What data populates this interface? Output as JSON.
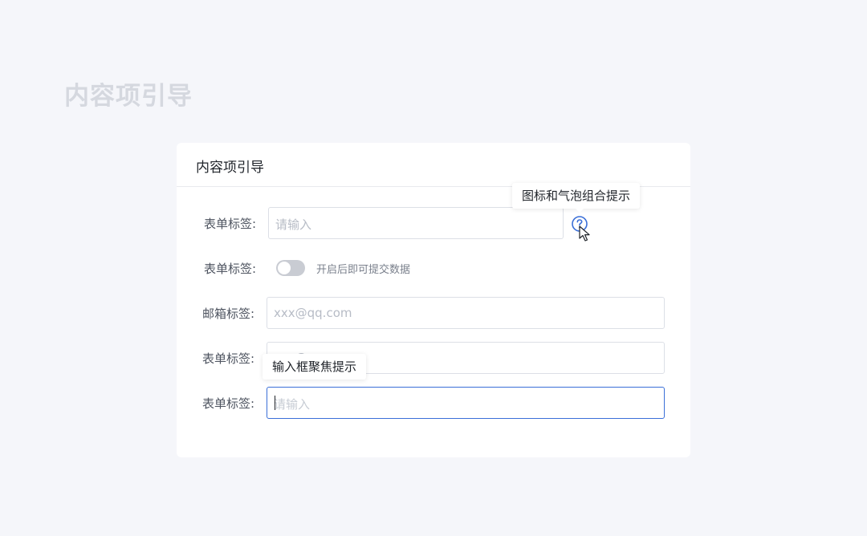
{
  "page": {
    "heading": "内容项引导"
  },
  "card": {
    "title": "内容项引导"
  },
  "form": {
    "row1": {
      "label": "表单标签:",
      "placeholder": "请输入"
    },
    "row2": {
      "label": "表单标签:",
      "toggle_on": false,
      "toggle_text": "开启后即可提交数据"
    },
    "row3": {
      "label": "邮箱标签:",
      "placeholder": "xxx@qq.com"
    },
    "row4": {
      "label": "表单标签:",
      "placeholder": "xxx@qq.com"
    },
    "row5": {
      "label": "表单标签:",
      "placeholder": "请输入"
    }
  },
  "tooltips": {
    "icon_bubble": "图标和气泡组合提示",
    "input_focus": "输入框聚焦提示"
  },
  "icons": {
    "help": "question-circle-icon",
    "cursor": "mouse-pointer-icon"
  },
  "colors": {
    "accent": "#3a6fd8",
    "page_background": "#f5f6fa",
    "card_background": "#ffffff",
    "toggle_off": "#c9ccd3"
  }
}
